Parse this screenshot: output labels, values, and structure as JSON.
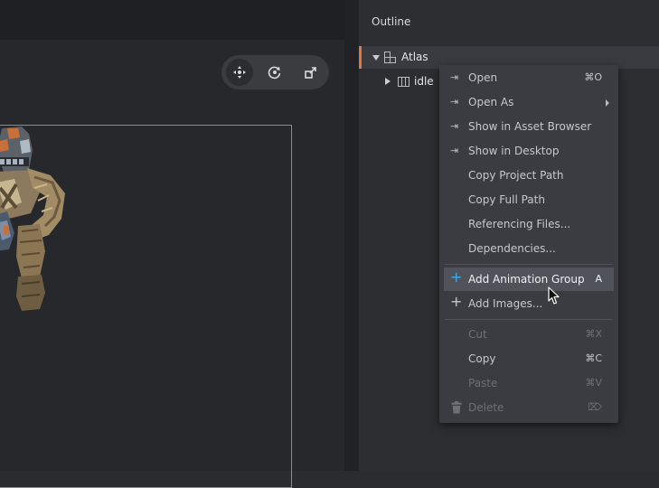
{
  "editor": {
    "tools": [
      {
        "name": "move-tool",
        "active": true
      },
      {
        "name": "rotate-tool",
        "active": false
      },
      {
        "name": "scale-tool",
        "active": false
      }
    ]
  },
  "outline": {
    "title": "Outline",
    "root": {
      "label": "Atlas",
      "expanded": true
    },
    "child": {
      "label": "idle",
      "expanded": false
    }
  },
  "context_menu": {
    "open": {
      "label": "Open",
      "shortcut": "⌘O"
    },
    "open_as": {
      "label": "Open As"
    },
    "show_asset_browser": {
      "label": "Show in Asset Browser"
    },
    "show_desktop": {
      "label": "Show in Desktop"
    },
    "copy_project_path": {
      "label": "Copy Project Path"
    },
    "copy_full_path": {
      "label": "Copy Full Path"
    },
    "referencing_files": {
      "label": "Referencing Files..."
    },
    "dependencies": {
      "label": "Dependencies..."
    },
    "add_animation_group": {
      "label": "Add Animation Group",
      "shortcut": "A"
    },
    "add_images": {
      "label": "Add Images..."
    },
    "cut": {
      "label": "Cut",
      "shortcut": "⌘X"
    },
    "copy": {
      "label": "Copy",
      "shortcut": "⌘C"
    },
    "paste": {
      "label": "Paste",
      "shortcut": "⌘V"
    },
    "delete": {
      "label": "Delete",
      "shortcut": "⌦"
    }
  },
  "colors": {
    "accent": "#e07a3c",
    "plus_icon": "#3fa9e8"
  }
}
